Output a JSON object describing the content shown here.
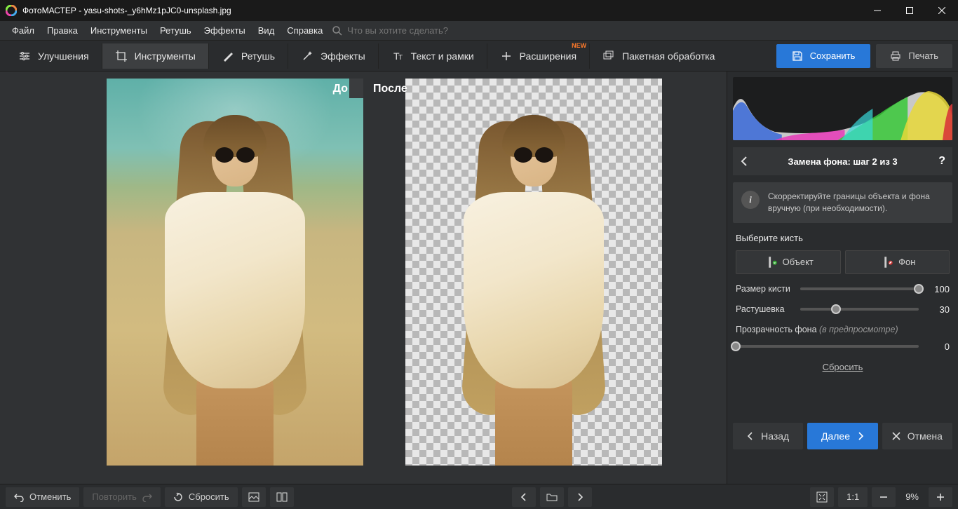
{
  "window": {
    "title": "ФотоМАСТЕР - yasu-shots-_y6hMz1pJC0-unsplash.jpg"
  },
  "menu": {
    "items": [
      "Файл",
      "Правка",
      "Инструменты",
      "Ретушь",
      "Эффекты",
      "Вид",
      "Справка"
    ],
    "search_placeholder": "Что вы хотите сделать?"
  },
  "tabs": {
    "enhance": "Улучшения",
    "tools": "Инструменты",
    "retouch": "Ретушь",
    "effects": "Эффекты",
    "text": "Текст и рамки",
    "extensions": "Расширения",
    "new_badge": "NEW",
    "batch": "Пакетная обработка",
    "save": "Сохранить",
    "print": "Печать"
  },
  "canvas": {
    "before_label": "До",
    "after_label": "После"
  },
  "panel": {
    "step_title": "Замена фона: шаг 2 из 3",
    "info_text": "Скорректируйте границы объекта и фона вручную (при необходимости).",
    "choose_brush": "Выберите кисть",
    "brush_object": "Объект",
    "brush_background": "Фон",
    "size_label": "Размер кисти",
    "size_value": "100",
    "feather_label": "Растушевка",
    "feather_value": "30",
    "opacity_label": "Прозрачность фона",
    "opacity_note": "(в предпросмотре)",
    "opacity_value": "0",
    "reset": "Сбросить",
    "back": "Назад",
    "next": "Далее",
    "cancel": "Отмена"
  },
  "bottom": {
    "undo": "Отменить",
    "redo": "Повторить",
    "reset": "Сбросить",
    "ratio": "1:1",
    "zoom": "9%"
  }
}
